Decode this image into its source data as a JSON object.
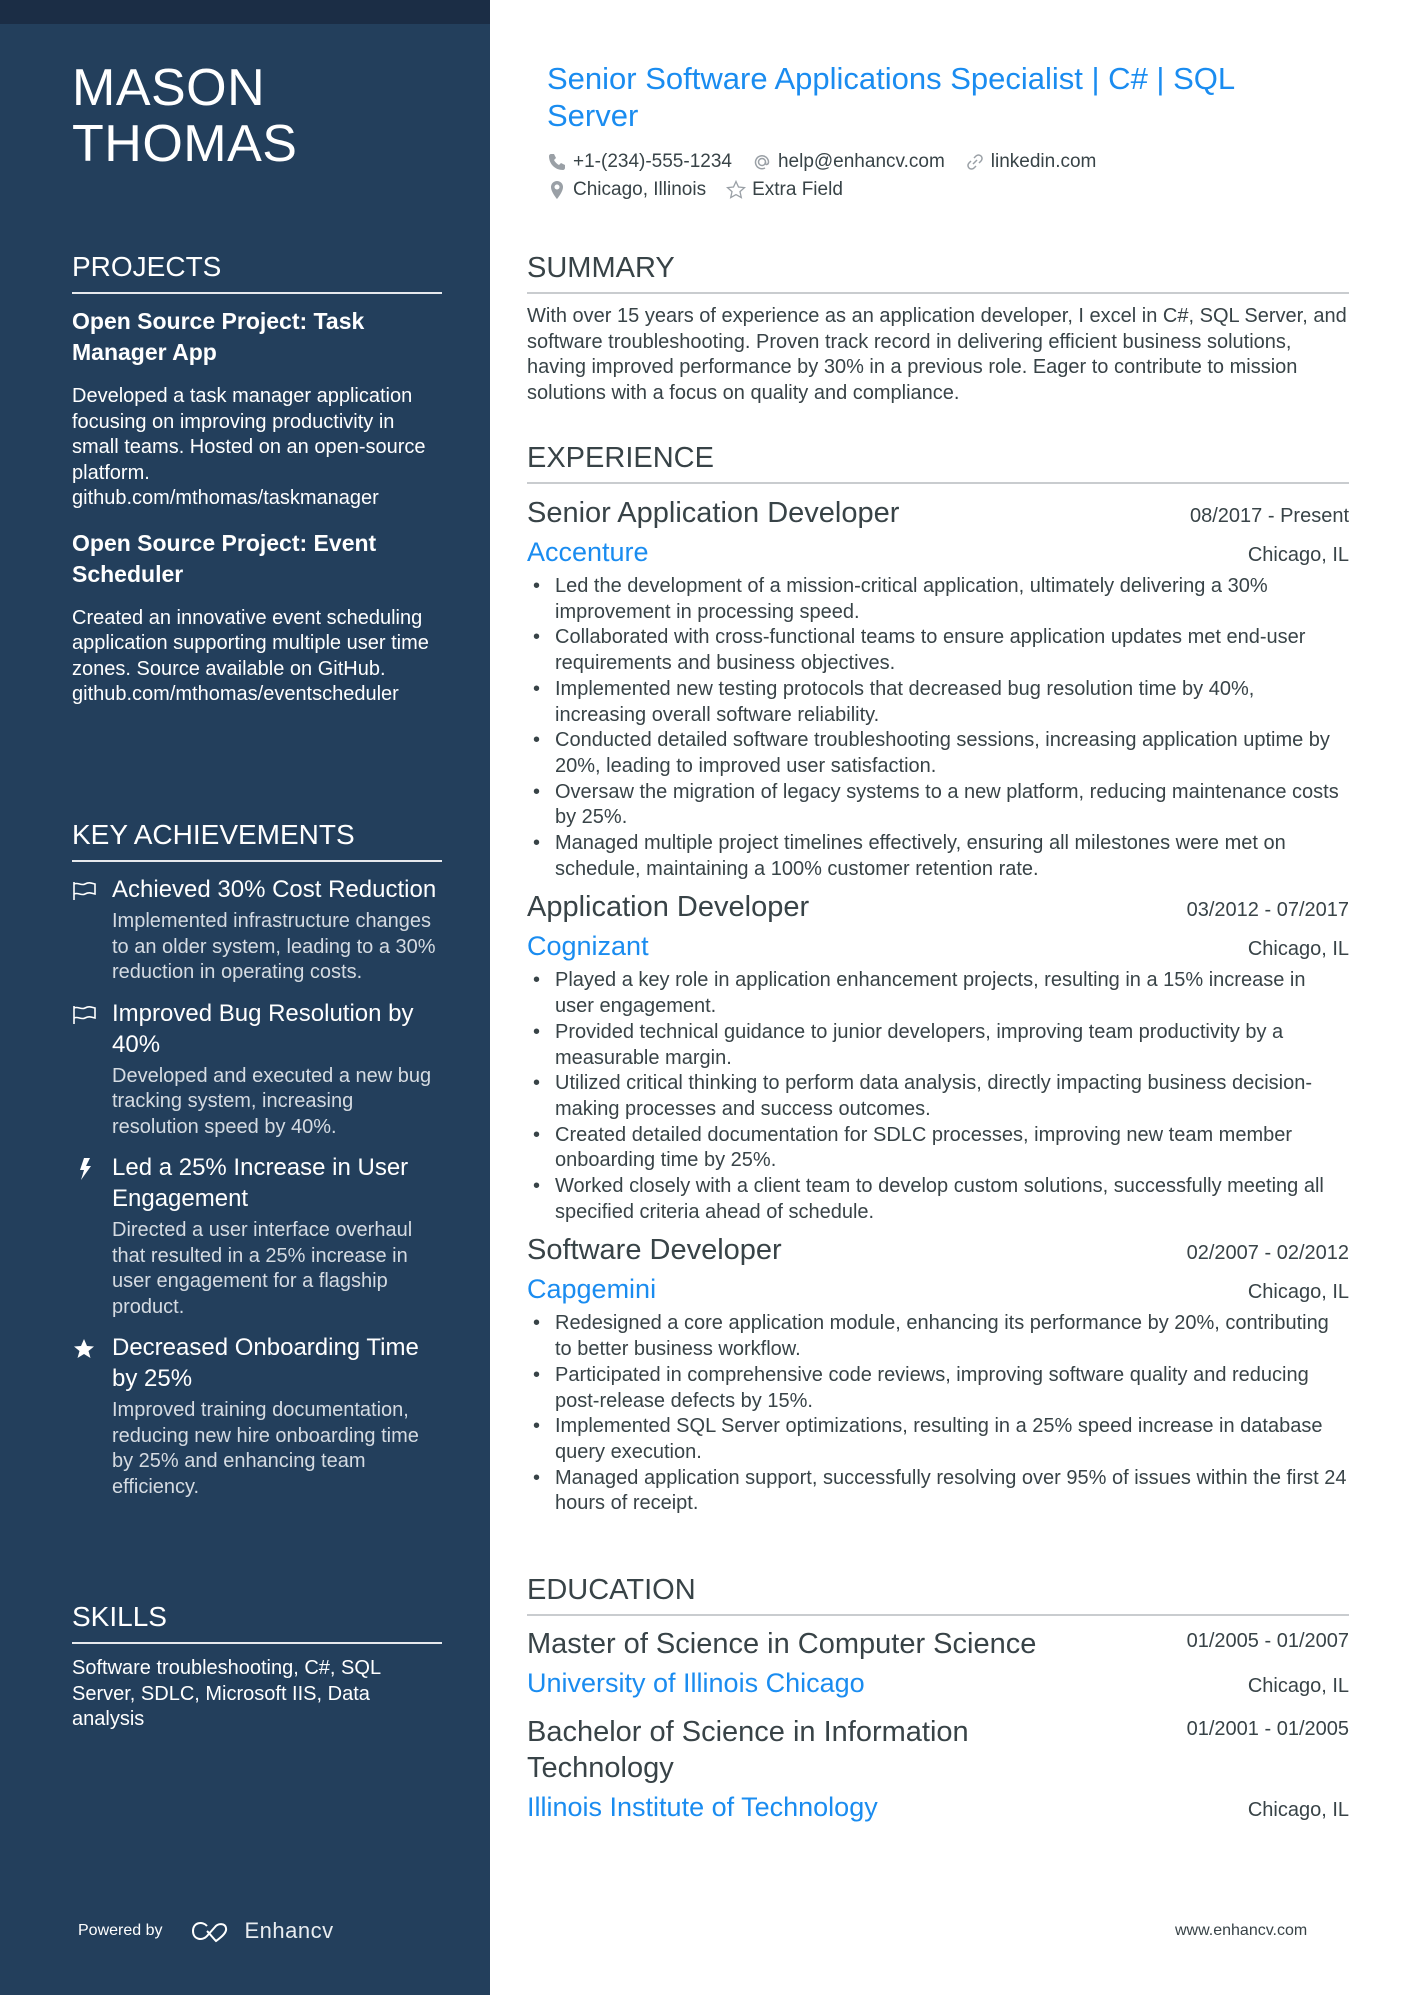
{
  "colors": {
    "sidebar_bg": "#233f5c",
    "sidebar_topbar": "#1b2d45",
    "accent": "#1a8cf0",
    "body_text": "#384347"
  },
  "sidebar": {
    "name_lines": [
      "MASON",
      "THOMAS"
    ],
    "projects": {
      "title": "PROJECTS",
      "items": [
        {
          "title": "Open Source Project: Task Manager App",
          "description": "Developed a task manager application focusing on improving productivity in small teams. Hosted on an open-source platform.",
          "link": "github.com/mthomas/taskmanager"
        },
        {
          "title": "Open Source Project: Event Scheduler",
          "description": "Created an innovative event scheduling application supporting multiple user time zones. Source available on GitHub.",
          "link": "github.com/mthomas/eventscheduler"
        }
      ]
    },
    "achievements": {
      "title": "KEY ACHIEVEMENTS",
      "items": [
        {
          "icon": "flag-icon",
          "title": "Achieved 30% Cost Reduction",
          "description": "Implemented infrastructure changes to an older system, leading to a 30% reduction in operating costs."
        },
        {
          "icon": "flag-icon",
          "title": "Improved Bug Resolution by 40%",
          "description": "Developed and executed a new bug tracking system, increasing resolution speed by 40%."
        },
        {
          "icon": "lightning-icon",
          "title": "Led a 25% Increase in User Engagement",
          "description": "Directed a user interface overhaul that resulted in a 25% increase in user engagement for a flagship product."
        },
        {
          "icon": "star-icon",
          "title": "Decreased Onboarding Time by 25%",
          "description": "Improved training documentation, reducing new hire onboarding time by 25% and enhancing team efficiency."
        }
      ]
    },
    "skills": {
      "title": "SKILLS",
      "text": "Software troubleshooting, C#, SQL Server, SDLC, Microsoft IIS, Data analysis"
    },
    "powered_by": {
      "label": "Powered by",
      "brand": "Enhancv"
    }
  },
  "main": {
    "headline": "Senior Software Applications Specialist | C# | SQL Server",
    "contacts": {
      "phone": "+1-(234)-555-1234",
      "email": "help@enhancv.com",
      "linkedin": "linkedin.com",
      "location": "Chicago, Illinois",
      "extra": "Extra Field"
    },
    "summary": {
      "title": "SUMMARY",
      "text": "With over 15 years of experience as an application developer, I excel in C#, SQL Server, and software troubleshooting. Proven track record in delivering efficient business solutions, having improved performance by 30% in a previous role. Eager to contribute to mission solutions with a focus on quality and compliance."
    },
    "experience": {
      "title": "EXPERIENCE",
      "jobs": [
        {
          "title": "Senior Application Developer",
          "dates": "08/2017 - Present",
          "company": "Accenture",
          "location": "Chicago, IL",
          "bullets": [
            "Led the development of a mission-critical application, ultimately delivering a 30% improvement in processing speed.",
            "Collaborated with cross-functional teams to ensure application updates met end-user requirements and business objectives.",
            "Implemented new testing protocols that decreased bug resolution time by 40%, increasing overall software reliability.",
            "Conducted detailed software troubleshooting sessions, increasing application uptime by 20%, leading to improved user satisfaction.",
            "Oversaw the migration of legacy systems to a new platform, reducing maintenance costs by 25%.",
            "Managed multiple project timelines effectively, ensuring all milestones were met on schedule, maintaining a 100% customer retention rate."
          ]
        },
        {
          "title": "Application Developer",
          "dates": "03/2012 - 07/2017",
          "company": "Cognizant",
          "location": "Chicago, IL",
          "bullets": [
            "Played a key role in application enhancement projects, resulting in a 15% increase in user engagement.",
            "Provided technical guidance to junior developers, improving team productivity by a measurable margin.",
            "Utilized critical thinking to perform data analysis, directly impacting business decision-making processes and success outcomes.",
            "Created detailed documentation for SDLC processes, improving new team member onboarding time by 25%.",
            "Worked closely with a client team to develop custom solutions, successfully meeting all specified criteria ahead of schedule."
          ]
        },
        {
          "title": "Software Developer",
          "dates": "02/2007 - 02/2012",
          "company": "Capgemini",
          "location": "Chicago, IL",
          "bullets": [
            "Redesigned a core application module, enhancing its performance by 20%, contributing to better business workflow.",
            "Participated in comprehensive code reviews, improving software quality and reducing post-release defects by 15%.",
            "Implemented SQL Server optimizations, resulting in a 25% speed increase in database query execution.",
            "Managed application support, successfully resolving over 95% of issues within the first 24 hours of receipt."
          ]
        }
      ]
    },
    "education": {
      "title": "EDUCATION",
      "items": [
        {
          "degree": "Master of Science in Computer Science",
          "dates": "01/2005 - 01/2007",
          "school": "University of Illinois Chicago",
          "location": "Chicago, IL"
        },
        {
          "degree": "Bachelor of Science in Information Technology",
          "dates": "01/2001 - 01/2005",
          "school": "Illinois Institute of Technology",
          "location": "Chicago, IL"
        }
      ]
    },
    "footer_url": "www.enhancv.com"
  }
}
